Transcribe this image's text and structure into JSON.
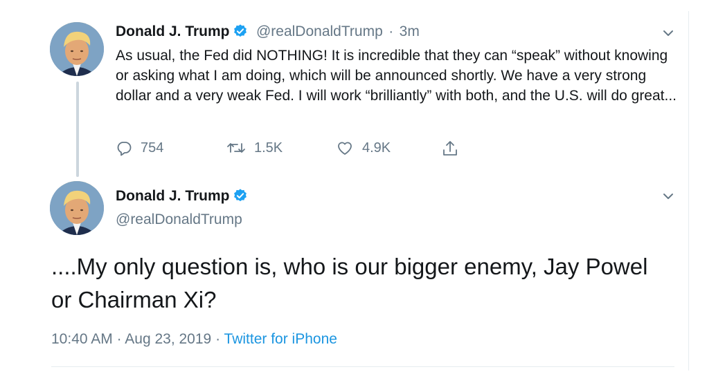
{
  "tweet1": {
    "author_name": "Donald J. Trump",
    "handle": "@realDonaldTrump",
    "separator": "·",
    "time": "3m",
    "text": "As usual, the Fed did NOTHING! It is incredible that they can “speak” without knowing or asking what I am doing, which will be announced shortly. We have a very strong dollar and a very weak Fed. I will work “brilliantly” with both, and the U.S. will do great...",
    "replies": "754",
    "retweets": "1.5K",
    "likes": "4.9K"
  },
  "tweet2": {
    "author_name": "Donald J. Trump",
    "handle": "@realDonaldTrump",
    "text": "....My only question is, who is our bigger enemy, Jay Powel or Chairman Xi?",
    "time": "10:40 AM",
    "separator1": "·",
    "date": "Aug 23, 2019",
    "separator2": "·",
    "source": "Twitter for iPhone"
  },
  "colors": {
    "accent": "#1da1f2",
    "secondary_text": "#657786",
    "link": "#1b95e0"
  },
  "icons": [
    "verified-badge-icon",
    "chevron-down-icon",
    "reply-icon",
    "retweet-icon",
    "like-icon",
    "share-icon"
  ]
}
